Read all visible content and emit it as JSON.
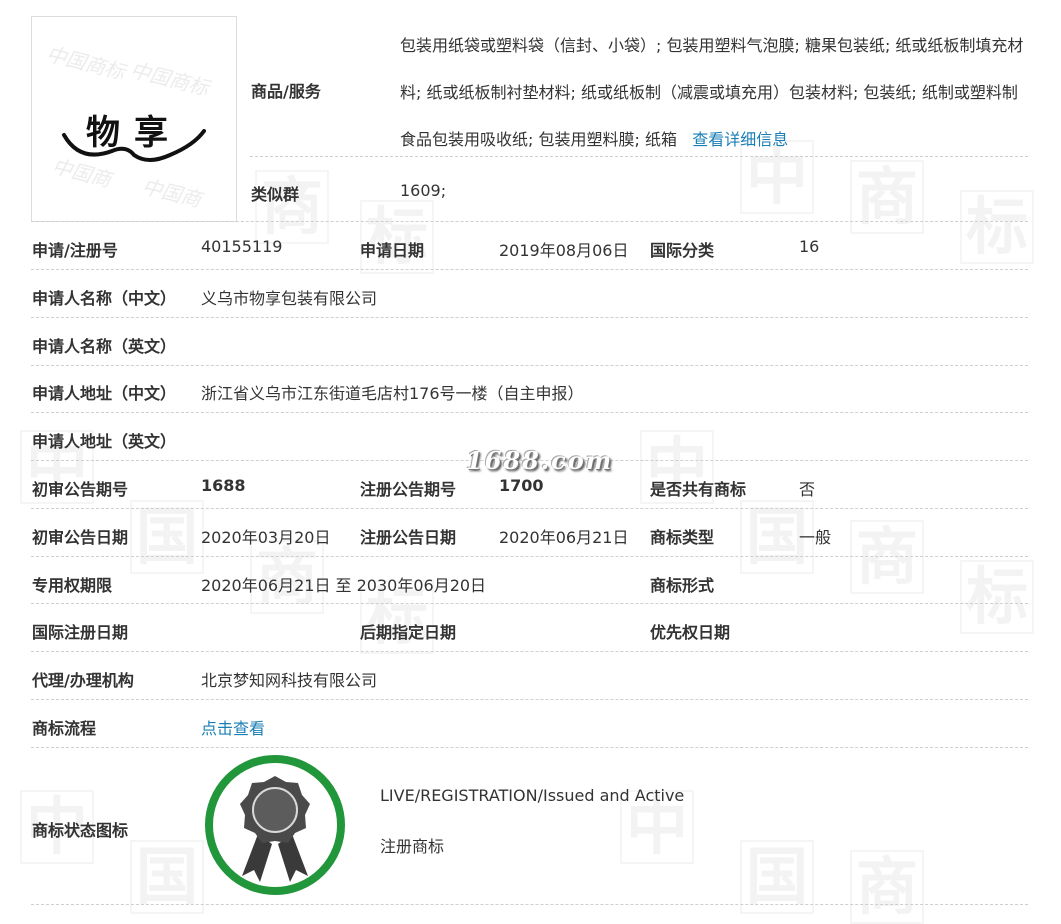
{
  "top": {
    "logo_alt": "物享",
    "goods_label": "商品/服务",
    "goods_text": "包装用纸袋或塑料袋（信封、小袋）; 包装用塑料气泡膜; 糖果包装纸; 纸或纸板制填充材料; 纸或纸板制衬垫材料; 纸或纸板制（减震或填充用）包装材料; 包装纸; 纸制或塑料制食品包装用吸收纸; 包装用塑料膜; 纸箱",
    "goods_link": "查看详细信息",
    "similar_label": "类似群",
    "similar_value": "1609;"
  },
  "fields": {
    "reg_no_label": "申请/注册号",
    "reg_no": "40155119",
    "app_date_label": "申请日期",
    "app_date": "2019年08月06日",
    "intl_class_label": "国际分类",
    "intl_class": "16",
    "applicant_cn_label": "申请人名称（中文）",
    "applicant_cn": "义乌市物享包装有限公司",
    "applicant_en_label": "申请人名称（英文）",
    "applicant_en": "",
    "address_cn_label": "申请人地址（中文）",
    "address_cn": "浙江省义乌市江东街道毛店村176号一楼（自主申报）",
    "address_en_label": "申请人地址（英文）",
    "address_en": "",
    "prelim_issue_label": "初审公告期号",
    "prelim_issue": "1688",
    "reg_issue_label": "注册公告期号",
    "reg_issue": "1700",
    "shared_label": "是否共有商标",
    "shared": "否",
    "prelim_date_label": "初审公告日期",
    "prelim_date": "2020年03月20日",
    "reg_date_label": "注册公告日期",
    "reg_date": "2020年06月21日",
    "type_label": "商标类型",
    "type": "一般",
    "exclusive_label": "专用权期限",
    "exclusive": "2020年06月21日 至 2030年06月20日",
    "form_label": "商标形式",
    "form": "",
    "intl_reg_date_label": "国际注册日期",
    "intl_reg_date": "",
    "later_date_label": "后期指定日期",
    "later_date": "",
    "priority_label": "优先权日期",
    "priority": "",
    "agent_label": "代理/办理机构",
    "agent": "北京梦知网科技有限公司",
    "flow_label": "商标流程",
    "flow_link": "点击查看",
    "status_icon_label": "商标状态图标",
    "status_en": "LIVE/REGISTRATION/Issued and Active",
    "status_cn": "注册商标"
  },
  "watermark": {
    "site": "1688.com",
    "tiles": [
      "中",
      "国",
      "商",
      "标"
    ]
  },
  "colors": {
    "link": "#1b7fb5",
    "badge_ring": "#22963a",
    "badge_ribbon": "#3a3a3a"
  }
}
